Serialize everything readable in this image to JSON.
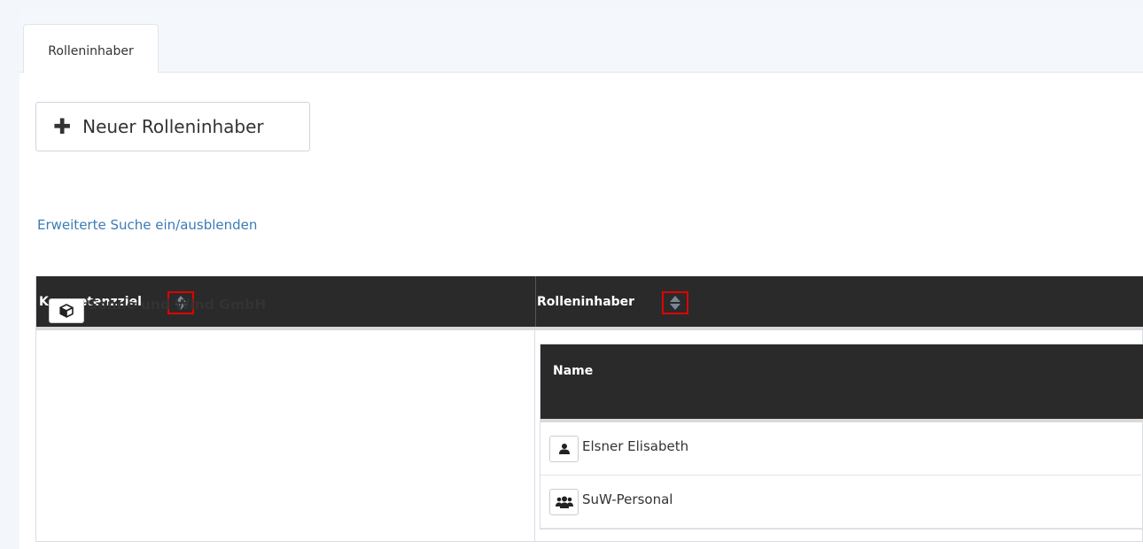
{
  "tabs": [
    {
      "label": "Rolleninhaber"
    }
  ],
  "toolbar": {
    "new_button_label": "Neuer Rolleninhaber",
    "new_button_icon": "plus-icon"
  },
  "search_toggle_label": "Erweiterte Suche ein/ausblenden",
  "table": {
    "columns": [
      "Kompetenzziel",
      "Rolleninhaber"
    ],
    "rows": [
      {
        "kompetenzziel": {
          "name": "Sonne und Wind GmbH",
          "icon": "cube-icon"
        },
        "rolleninhaber": {
          "header": "Name",
          "items": [
            {
              "name": "Elsner Elisabeth",
              "icon": "user-icon"
            },
            {
              "name": "SuW-Personal",
              "icon": "users-icon"
            }
          ]
        }
      }
    ]
  },
  "colors": {
    "link": "#3c7bb5",
    "header_bg": "#2a2a2a",
    "highlight_border": "#e10000"
  }
}
